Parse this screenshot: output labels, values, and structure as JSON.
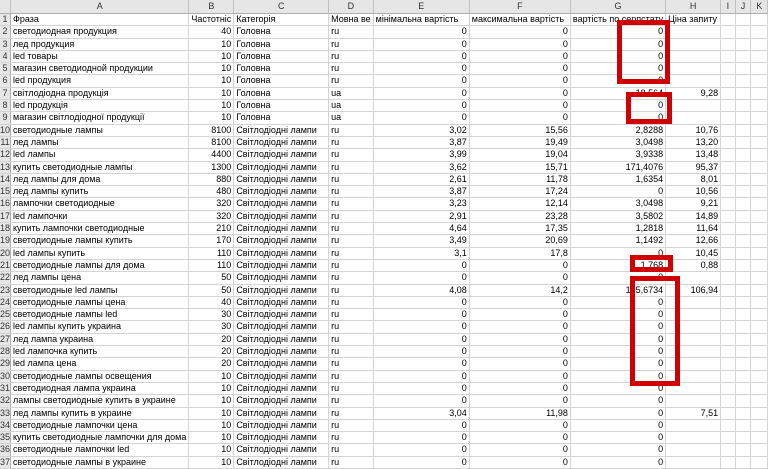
{
  "columns": [
    "A",
    "B",
    "C",
    "D",
    "E",
    "F",
    "G",
    "H",
    "I",
    "J",
    "K"
  ],
  "header": {
    "row_number": "1",
    "cells": [
      "Фраза",
      "Частотніс",
      "Категорія",
      "Мовна ве",
      "мінімальна вартість",
      "максимальна вартість",
      "вартість по серпстату",
      "Ціна запиту",
      "",
      "",
      ""
    ]
  },
  "rows": [
    {
      "n": "2",
      "cells": [
        "светодиодная продукция",
        "40",
        "Головна",
        "ru",
        "0",
        "0",
        "0",
        "",
        "",
        "",
        ""
      ]
    },
    {
      "n": "3",
      "cells": [
        "лед продукция",
        "10",
        "Головна",
        "ru",
        "0",
        "0",
        "0",
        "",
        "",
        "",
        ""
      ]
    },
    {
      "n": "4",
      "cells": [
        "led товары",
        "10",
        "Головна",
        "ru",
        "0",
        "0",
        "0",
        "",
        "",
        "",
        ""
      ]
    },
    {
      "n": "5",
      "cells": [
        "магазин светодиодной продукции",
        "10",
        "Головна",
        "ru",
        "0",
        "0",
        "0",
        "",
        "",
        "",
        ""
      ]
    },
    {
      "n": "6",
      "cells": [
        "led продукция",
        "10",
        "Головна",
        "ru",
        "0",
        "0",
        "0",
        "",
        "",
        "",
        ""
      ]
    },
    {
      "n": "7",
      "cells": [
        "світлодіодна продукція",
        "10",
        "Головна",
        "ua",
        "0",
        "0",
        "18,564",
        "9,28",
        "",
        "",
        ""
      ]
    },
    {
      "n": "8",
      "cells": [
        "led продукція",
        "10",
        "Головна",
        "ua",
        "0",
        "0",
        "0",
        "",
        "",
        "",
        ""
      ]
    },
    {
      "n": "9",
      "cells": [
        "магазин світлодіодної продукції",
        "10",
        "Головна",
        "ua",
        "0",
        "0",
        "0",
        "",
        "",
        "",
        ""
      ]
    },
    {
      "n": "10",
      "cells": [
        "светодиодные лампы",
        "8100",
        "Світлодіодні лампи",
        "ru",
        "3,02",
        "15,56",
        "2,8288",
        "10,76",
        "",
        "",
        ""
      ]
    },
    {
      "n": "11",
      "cells": [
        "лед лампы",
        "8100",
        "Світлодіодні лампи",
        "ru",
        "3,87",
        "19,49",
        "3,0498",
        "13,20",
        "",
        "",
        ""
      ]
    },
    {
      "n": "12",
      "cells": [
        "led лампы",
        "4400",
        "Світлодіодні лампи",
        "ru",
        "3,99",
        "19,04",
        "3,9338",
        "13,48",
        "",
        "",
        ""
      ]
    },
    {
      "n": "13",
      "cells": [
        "купить светодиодные лампы",
        "1300",
        "Світлодіодні лампи",
        "ru",
        "3,62",
        "15,71",
        "171,4076",
        "95,37",
        "",
        "",
        ""
      ]
    },
    {
      "n": "14",
      "cells": [
        "лед лампы для дома",
        "880",
        "Світлодіодні лампи",
        "ru",
        "2,61",
        "11,78",
        "1,6354",
        "8,01",
        "",
        "",
        ""
      ]
    },
    {
      "n": "15",
      "cells": [
        "лед лампы купить",
        "480",
        "Світлодіодні лампи",
        "ru",
        "3,87",
        "17,24",
        "0",
        "10,56",
        "",
        "",
        ""
      ]
    },
    {
      "n": "16",
      "cells": [
        "лампочки светодиодные",
        "320",
        "Світлодіодні лампи",
        "ru",
        "3,23",
        "12,14",
        "3,0498",
        "9,21",
        "",
        "",
        ""
      ]
    },
    {
      "n": "17",
      "cells": [
        "led лампочки",
        "320",
        "Світлодіодні лампи",
        "ru",
        "2,91",
        "23,28",
        "3,5802",
        "14,89",
        "",
        "",
        ""
      ]
    },
    {
      "n": "18",
      "cells": [
        "купить лампочки светодиодные",
        "210",
        "Світлодіодні лампи",
        "ru",
        "4,64",
        "17,35",
        "1,2818",
        "11,64",
        "",
        "",
        ""
      ]
    },
    {
      "n": "19",
      "cells": [
        "светодиодные лампы купить",
        "170",
        "Світлодіодні лампи",
        "ru",
        "3,49",
        "20,69",
        "1,1492",
        "12,66",
        "",
        "",
        ""
      ]
    },
    {
      "n": "20",
      "cells": [
        "led лампы купить",
        "110",
        "Світлодіодні лампи",
        "ru",
        "3,1",
        "17,8",
        "0",
        "10,45",
        "",
        "",
        ""
      ]
    },
    {
      "n": "21",
      "cells": [
        "светодиодные лампы для дома",
        "110",
        "Світлодіодні лампи",
        "ru",
        "0",
        "0",
        "1,768",
        "0,88",
        "",
        "",
        ""
      ]
    },
    {
      "n": "22",
      "cells": [
        "лед лампы цена",
        "50",
        "Світлодіодні лампи",
        "ru",
        "0",
        "0",
        "0",
        "",
        "",
        "",
        ""
      ]
    },
    {
      "n": "23",
      "cells": [
        "светодиодные led лампы",
        "50",
        "Світлодіодні лампи",
        "ru",
        "4,08",
        "14,2",
        "195,6734",
        "106,94",
        "",
        "",
        ""
      ]
    },
    {
      "n": "24",
      "cells": [
        "светодиодные лампы цена",
        "40",
        "Світлодіодні лампи",
        "ru",
        "0",
        "0",
        "0",
        "",
        "",
        "",
        ""
      ]
    },
    {
      "n": "25",
      "cells": [
        "светодиодные лампы led",
        "30",
        "Світлодіодні лампи",
        "ru",
        "0",
        "0",
        "0",
        "",
        "",
        "",
        ""
      ]
    },
    {
      "n": "26",
      "cells": [
        "led лампы купить украина",
        "30",
        "Світлодіодні лампи",
        "ru",
        "0",
        "0",
        "0",
        "",
        "",
        "",
        ""
      ]
    },
    {
      "n": "27",
      "cells": [
        "лед лампа украина",
        "20",
        "Світлодіодні лампи",
        "ru",
        "0",
        "0",
        "0",
        "",
        "",
        "",
        ""
      ]
    },
    {
      "n": "28",
      "cells": [
        "led лампочка купить",
        "20",
        "Світлодіодні лампи",
        "ru",
        "0",
        "0",
        "0",
        "",
        "",
        "",
        ""
      ]
    },
    {
      "n": "29",
      "cells": [
        "led лампа цена",
        "20",
        "Світлодіодні лампи",
        "ru",
        "0",
        "0",
        "0",
        "",
        "",
        "",
        ""
      ]
    },
    {
      "n": "30",
      "cells": [
        "светодиодные лампы освещения",
        "10",
        "Світлодіодні лампи",
        "ru",
        "0",
        "0",
        "0",
        "",
        "",
        "",
        ""
      ]
    },
    {
      "n": "31",
      "cells": [
        "светодиодная лампа украина",
        "10",
        "Світлодіодні лампи",
        "ru",
        "0",
        "0",
        "0",
        "",
        "",
        "",
        ""
      ]
    },
    {
      "n": "32",
      "cells": [
        "лампы светодиодные купить в украине",
        "10",
        "Світлодіодні лампи",
        "ru",
        "0",
        "0",
        "0",
        "",
        "",
        "",
        ""
      ]
    },
    {
      "n": "33",
      "cells": [
        "лед лампы купить в украине",
        "10",
        "Світлодіодні лампи",
        "ru",
        "3,04",
        "11,98",
        "0",
        "7,51",
        "",
        "",
        ""
      ]
    },
    {
      "n": "34",
      "cells": [
        "светодиодные лампочки цена",
        "10",
        "Світлодіодні лампи",
        "ru",
        "0",
        "0",
        "0",
        "",
        "",
        "",
        ""
      ]
    },
    {
      "n": "35",
      "cells": [
        "купить светодиодные лампочки для дома",
        "10",
        "Світлодіодні лампи",
        "ru",
        "0",
        "0",
        "0",
        "",
        "",
        "",
        ""
      ]
    },
    {
      "n": "36",
      "cells": [
        "светодиодные лампочки led",
        "10",
        "Світлодіодні лампи",
        "ru",
        "0",
        "0",
        "0",
        "",
        "",
        "",
        ""
      ]
    },
    {
      "n": "37",
      "cells": [
        "светодиодные лампы в украине",
        "10",
        "Світлодіодні лампи",
        "ru",
        "0",
        "0",
        "0",
        "",
        "",
        "",
        ""
      ]
    }
  ],
  "annotation_color": "#d00000"
}
